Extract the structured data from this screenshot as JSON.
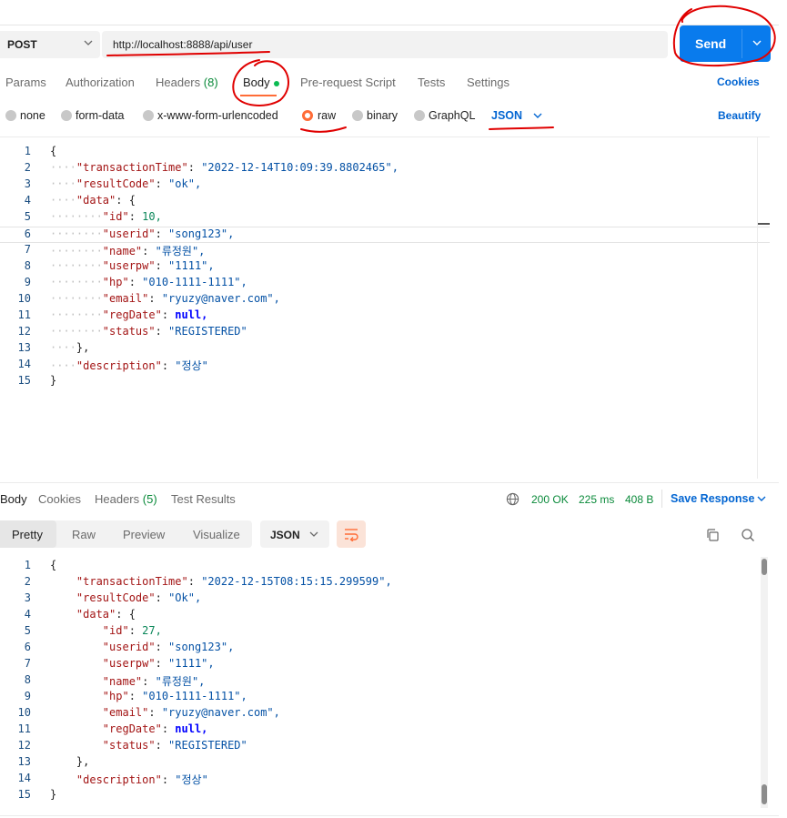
{
  "request": {
    "method": "POST",
    "url": "http://localhost:8888/api/user",
    "send_label": "Send"
  },
  "request_tabs": {
    "params": "Params",
    "authorization": "Authorization",
    "headers": "Headers",
    "headers_count": "(8)",
    "body": "Body",
    "prerequest": "Pre-request Script",
    "tests": "Tests",
    "settings": "Settings",
    "cookies": "Cookies"
  },
  "body_types": {
    "none": "none",
    "form_data": "form-data",
    "urlencoded": "x-www-form-urlencoded",
    "raw": "raw",
    "binary": "binary",
    "graphql": "GraphQL",
    "format": "JSON",
    "beautify": "Beautify"
  },
  "request_body": [
    {
      "n": "1",
      "dots": "",
      "text": "{"
    },
    {
      "n": "2",
      "dots": "····",
      "text": "\"transactionTime\": \"2022-12-14T10:09:39.8802465\","
    },
    {
      "n": "3",
      "dots": "····",
      "text": "\"resultCode\": \"ok\","
    },
    {
      "n": "4",
      "dots": "····",
      "text": "\"data\": {"
    },
    {
      "n": "5",
      "dots": "········",
      "text": "\"id\": 10,"
    },
    {
      "n": "6",
      "dots": "········",
      "text": "\"userid\": \"song123\","
    },
    {
      "n": "7",
      "dots": "········",
      "text": "\"name\": \"류정원\","
    },
    {
      "n": "8",
      "dots": "········",
      "text": "\"userpw\": \"1111\","
    },
    {
      "n": "9",
      "dots": "········",
      "text": "\"hp\": \"010-1111-1111\","
    },
    {
      "n": "10",
      "dots": "········",
      "text": "\"email\": \"ryuzy@naver.com\","
    },
    {
      "n": "11",
      "dots": "········",
      "text": "\"regDate\": null,"
    },
    {
      "n": "12",
      "dots": "········",
      "text": "\"status\": \"REGISTERED\""
    },
    {
      "n": "13",
      "dots": "····",
      "text": "},"
    },
    {
      "n": "14",
      "dots": "····",
      "text": "\"description\": \"정상\""
    },
    {
      "n": "15",
      "dots": "",
      "text": "}"
    }
  ],
  "response_tabs": {
    "body": "Body",
    "cookies": "Cookies",
    "headers": "Headers",
    "headers_count": "(5)",
    "test_results": "Test Results",
    "status": "200 OK",
    "time": "225 ms",
    "size": "408 B",
    "save_response": "Save Response"
  },
  "response_view": {
    "pretty": "Pretty",
    "raw": "Raw",
    "preview": "Preview",
    "visualize": "Visualize",
    "format": "JSON"
  },
  "response_body": [
    {
      "n": "1",
      "dots": "",
      "text": "{"
    },
    {
      "n": "2",
      "dots": "    ",
      "text": "\"transactionTime\": \"2022-12-15T08:15:15.299599\","
    },
    {
      "n": "3",
      "dots": "    ",
      "text": "\"resultCode\": \"Ok\","
    },
    {
      "n": "4",
      "dots": "    ",
      "text": "\"data\": {"
    },
    {
      "n": "5",
      "dots": "        ",
      "text": "\"id\": 27,"
    },
    {
      "n": "6",
      "dots": "        ",
      "text": "\"userid\": \"song123\","
    },
    {
      "n": "7",
      "dots": "        ",
      "text": "\"userpw\": \"1111\","
    },
    {
      "n": "8",
      "dots": "        ",
      "text": "\"name\": \"류정원\","
    },
    {
      "n": "9",
      "dots": "        ",
      "text": "\"hp\": \"010-1111-1111\","
    },
    {
      "n": "10",
      "dots": "        ",
      "text": "\"email\": \"ryuzy@naver.com\","
    },
    {
      "n": "11",
      "dots": "        ",
      "text": "\"regDate\": null,"
    },
    {
      "n": "12",
      "dots": "        ",
      "text": "\"status\": \"REGISTERED\""
    },
    {
      "n": "13",
      "dots": "    ",
      "text": "},"
    },
    {
      "n": "14",
      "dots": "    ",
      "text": "\"description\": \"정상\""
    },
    {
      "n": "15",
      "dots": "",
      "text": "}"
    }
  ],
  "colors": {
    "accent": "#ff6c37",
    "send": "#097bed",
    "link": "#0265d2",
    "success": "#0a8a3a",
    "annotation": "#e00000"
  }
}
